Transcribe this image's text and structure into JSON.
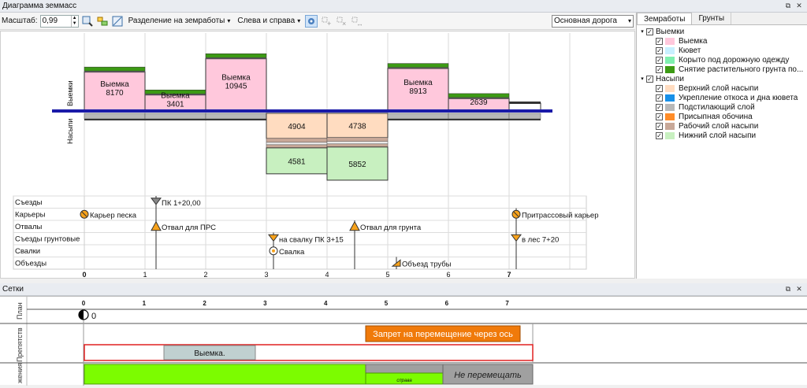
{
  "window_title": "Диаграмма земмасс",
  "window_buttons": [
    "⧉",
    "✕"
  ],
  "toolbar": {
    "scale_label": "Масштаб:",
    "scale_value": "0,99",
    "division_combo": "Разделение на земработы",
    "side_combo": "Слева и справа",
    "road_combo": "Основная дорога"
  },
  "chart_data": {
    "type": "bar",
    "categories": [
      "0–1",
      "1–2",
      "2–3",
      "3–4",
      "4–5",
      "5–6",
      "6–7",
      "7+"
    ],
    "axis_labels": {
      "cut": "Выемки",
      "fill": "Насыпи"
    },
    "x_ticks": [
      "0",
      "1",
      "2",
      "3",
      "4",
      "5",
      "6",
      "7"
    ],
    "series": [
      {
        "name": "Выемка",
        "values": [
          8170,
          3401,
          10945,
          0,
          0,
          8913,
          2639,
          0
        ],
        "labels": [
          "Выемка\n8170",
          "Выемка\n3401",
          "Выемка\n10945",
          "",
          "",
          "Выемка\n8913",
          "2639",
          ""
        ]
      },
      {
        "name": "Верхний слой насыпи",
        "values": [
          0,
          0,
          0,
          4904,
          4738,
          0,
          0,
          0
        ],
        "labels": [
          "",
          "",
          "",
          "4904",
          "4738",
          "",
          "",
          ""
        ]
      },
      {
        "name": "Нижний слой насыпи",
        "values": [
          0,
          0,
          0,
          4581,
          5852,
          0,
          0,
          0
        ],
        "labels": [
          "",
          "",
          "",
          "4581",
          "5852",
          "",
          "",
          ""
        ]
      }
    ],
    "grid": true
  },
  "track_rows": [
    {
      "name": "Съезды",
      "marks": [
        {
          "text": "ПК 1+20,00",
          "icon": "funnel-icon"
        }
      ]
    },
    {
      "name": "Карьеры",
      "marks": [
        {
          "text": "Карьер песка",
          "icon": "quarry-icon"
        },
        {
          "text": "Притрассовый карьер",
          "icon": "quarry-icon"
        }
      ]
    },
    {
      "name": "Отвалы",
      "marks": [
        {
          "text": "Отвал для ПРС",
          "icon": "warning-icon"
        },
        {
          "text": "Отвал для грунта",
          "icon": "warning-icon"
        }
      ]
    },
    {
      "name": "Съезды грунтовые",
      "marks": [
        {
          "text": "на свалку ПК 3+15",
          "icon": "funnel-icon"
        },
        {
          "text": "в лес 7+20",
          "icon": "funnel-icon"
        }
      ]
    },
    {
      "name": "Свалки",
      "marks": [
        {
          "text": "Свалка",
          "icon": "dump-icon"
        }
      ]
    },
    {
      "name": "Объезды",
      "marks": [
        {
          "text": "Объезд трубы",
          "icon": "detour-icon"
        }
      ]
    }
  ],
  "right_tabs": [
    "Земработы",
    "Грунты"
  ],
  "legend": [
    {
      "group": "Выемки",
      "items": [
        {
          "label": "Выемка",
          "color": "#ffc8dc"
        },
        {
          "label": "Кювет",
          "color": "#c8f0ff"
        },
        {
          "label": "Корыто под дорожную одежду",
          "color": "#7ff0b0"
        },
        {
          "label": "Снятие растительного грунта по...",
          "color": "#3c9a14"
        }
      ]
    },
    {
      "group": "Насыпи",
      "items": [
        {
          "label": "Верхний слой насыпи",
          "color": "#ffdcc0"
        },
        {
          "label": "Укрепление откоса и дна кювета",
          "color": "#1890e8"
        },
        {
          "label": "Подстилающий слой",
          "color": "#b8b8b8"
        },
        {
          "label": "Присыпная обочина",
          "color": "#ff8c28"
        },
        {
          "label": "Рабочий слой насыпи",
          "color": "#c8a898"
        },
        {
          "label": "Нижний слой насыпи",
          "color": "#c8f0c0"
        }
      ]
    }
  ],
  "grids": {
    "title": "Сетки",
    "row_labels": [
      "План",
      "Препятств",
      "жения"
    ],
    "ticks": [
      "0",
      "1",
      "2",
      "3",
      "4",
      "5",
      "6",
      "7"
    ],
    "plan_value": "0",
    "ban_label": "Запрет на перемещение через ось",
    "cut_label": "Выемка.",
    "small_label": "справа",
    "no_move_label": "Не перемещать"
  }
}
